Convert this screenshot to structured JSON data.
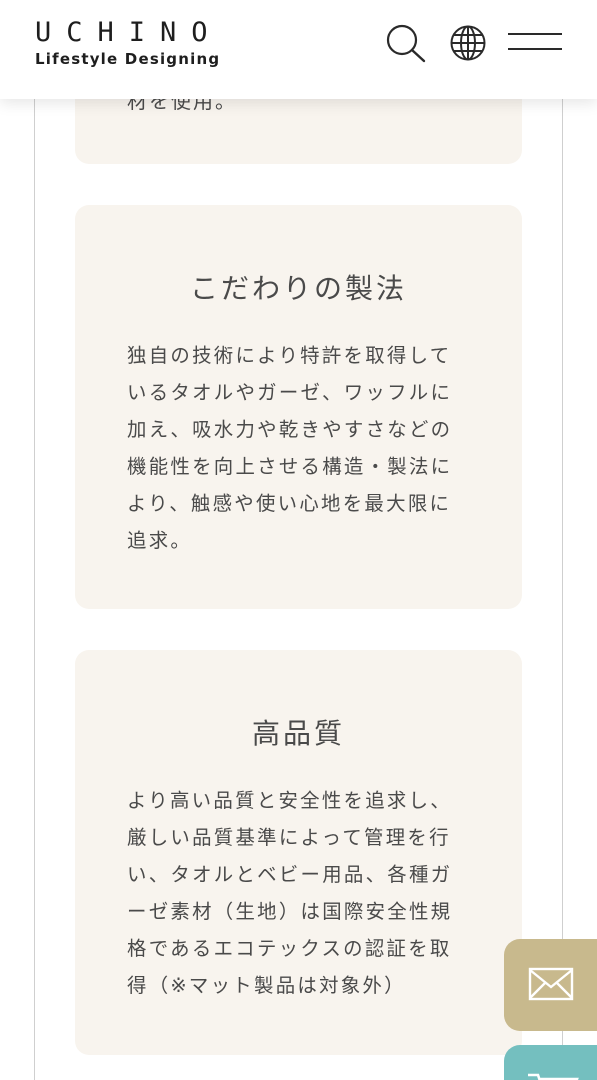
{
  "header": {
    "logo_word": "UCHINO",
    "logo_sub": "Lifestyle Designing",
    "search_icon": "search-icon",
    "globe_icon": "globe-icon",
    "menu_icon": "hamburger-menu-icon"
  },
  "cards": {
    "top_tail": "材を使用。",
    "craft": {
      "title": "こだわりの製法",
      "lines": [
        "独自の技術により特許を取得して",
        "いるタオルやガーゼ、ワッフルに",
        "加え、吸水力や乾きやすさなどの",
        "機能性を向上させる構造・製法に",
        "より、触感や使い心地を最大限に",
        "追求。"
      ]
    },
    "quality": {
      "title": "高品質",
      "lines": [
        "より高い品質と安全性を追求し、",
        "厳しい品質基準によって管理を行",
        "い、タオルとベビー用品、各種ガ",
        "ーゼ素材（生地）は国際安全性規",
        "格であるエコテックスの認証を取",
        "得（※マット製品は対象外）"
      ]
    }
  },
  "floating": {
    "mail_icon": "mail-icon",
    "cart_icon": "cart-icon"
  },
  "colors": {
    "card_bg": "#f8f4ee",
    "mail_button": "#c8b98d",
    "cart_button": "#74bfbf",
    "text": "#4a4a4a"
  }
}
